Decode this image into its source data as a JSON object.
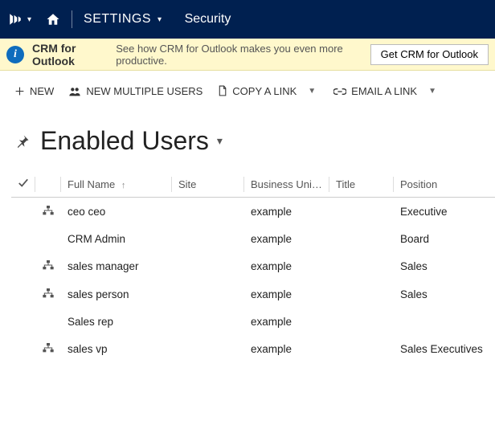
{
  "nav": {
    "settings_label": "SETTINGS",
    "breadcrumb_current": "Security"
  },
  "notice": {
    "title": "CRM for Outlook",
    "message": "See how CRM for Outlook makes you even more productive.",
    "button_label": "Get CRM for Outlook"
  },
  "commands": {
    "new": "NEW",
    "new_multiple": "NEW MULTIPLE USERS",
    "copy_link": "COPY A LINK",
    "email_link": "EMAIL A LINK"
  },
  "view": {
    "title": "Enabled Users"
  },
  "grid": {
    "columns": {
      "full_name": "Full Name",
      "site": "Site",
      "business_unit": "Business Unit…",
      "title": "Title",
      "position": "Position"
    },
    "rows": [
      {
        "has_hierarchy": true,
        "full_name": "ceo ceo",
        "site": "",
        "business_unit": "example",
        "title": "",
        "position": "Executive"
      },
      {
        "has_hierarchy": false,
        "full_name": "CRM Admin",
        "site": "",
        "business_unit": "example",
        "title": "",
        "position": "Board"
      },
      {
        "has_hierarchy": true,
        "full_name": "sales manager",
        "site": "",
        "business_unit": "example",
        "title": "",
        "position": "Sales"
      },
      {
        "has_hierarchy": true,
        "full_name": "sales person",
        "site": "",
        "business_unit": "example",
        "title": "",
        "position": "Sales"
      },
      {
        "has_hierarchy": false,
        "full_name": "Sales rep",
        "site": "",
        "business_unit": "example",
        "title": "",
        "position": ""
      },
      {
        "has_hierarchy": true,
        "full_name": "sales vp",
        "site": "",
        "business_unit": "example",
        "title": "",
        "position": "Sales Executives"
      }
    ]
  }
}
